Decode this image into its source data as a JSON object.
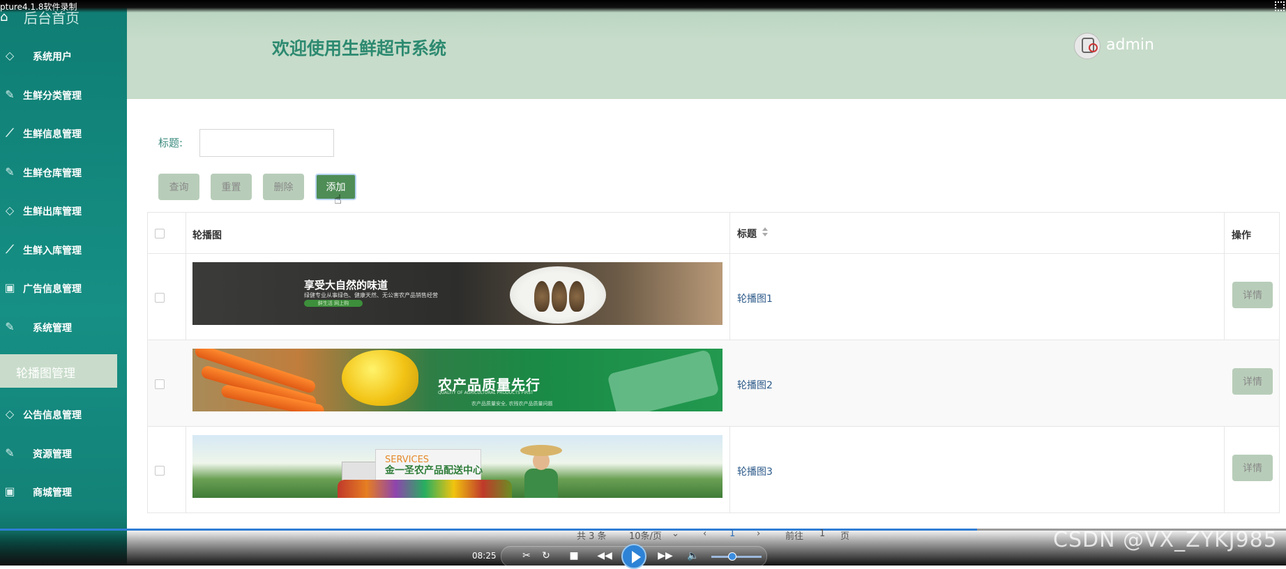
{
  "recorder": {
    "title": "pture4.1.8软件录制"
  },
  "sidebar": {
    "home_label": "后台首页",
    "items": [
      {
        "label": "系统用户",
        "icon": "diamond-icon"
      },
      {
        "label": "生鲜分类管理",
        "icon": "edit-icon"
      },
      {
        "label": "生鲜信息管理",
        "icon": "chart-icon"
      },
      {
        "label": "生鲜仓库管理",
        "icon": "edit-icon"
      },
      {
        "label": "生鲜出库管理",
        "icon": "diamond-icon"
      },
      {
        "label": "生鲜入库管理",
        "icon": "chart-icon"
      },
      {
        "label": "广告信息管理",
        "icon": "badge-icon"
      },
      {
        "label": "系统管理",
        "icon": "edit-icon"
      },
      {
        "label": "公告信息管理",
        "icon": "diamond-icon"
      },
      {
        "label": "资源管理",
        "icon": "edit-icon"
      },
      {
        "label": "商城管理",
        "icon": "badge-icon"
      }
    ],
    "active_sub": "轮播图管理"
  },
  "header": {
    "title": "欢迎使用生鲜超市系统",
    "username": "admin"
  },
  "search": {
    "label": "标题:",
    "value": "",
    "placeholder": ""
  },
  "toolbar": {
    "query": "查询",
    "reset": "重置",
    "delete": "删除",
    "add": "添加"
  },
  "table": {
    "headers": {
      "image": "轮播图",
      "title": "标题",
      "actions": "操作"
    },
    "rows": [
      {
        "title": "轮播图1",
        "action": "详情",
        "banner_text": [
          "享受大自然的味道",
          "绿健专业从事绿色、健康天然、无公害农产品销售经营",
          "鲜生活 网上购"
        ]
      },
      {
        "title": "轮播图2",
        "action": "详情",
        "banner_text": [
          "农产品质量先行",
          "QUALITY OF AGRICULTURAL PRODUCTS FIRST",
          "农产品质量安全, 农残农产品质量问题"
        ]
      },
      {
        "title": "轮播图3",
        "action": "详情",
        "banner_text": [
          "SERVICES",
          "金一圣农产品配送中心"
        ]
      }
    ]
  },
  "pagination": {
    "total": "共 3 条",
    "page_size": "10条/页",
    "current": "1",
    "goto_prefix": "前往",
    "goto_value": "1",
    "goto_suffix": "页"
  },
  "player": {
    "time": "08:25",
    "progress": 0.76,
    "volume": 0.4
  },
  "watermark": "CSDN @VX_ZYKJ985",
  "colors": {
    "sidebar": "#168f84",
    "header": "#c7dcca",
    "accent": "#2d8a70",
    "button": "#b8cdb9",
    "add_button": "#4e8d56",
    "player_play": "#2e83d6"
  }
}
